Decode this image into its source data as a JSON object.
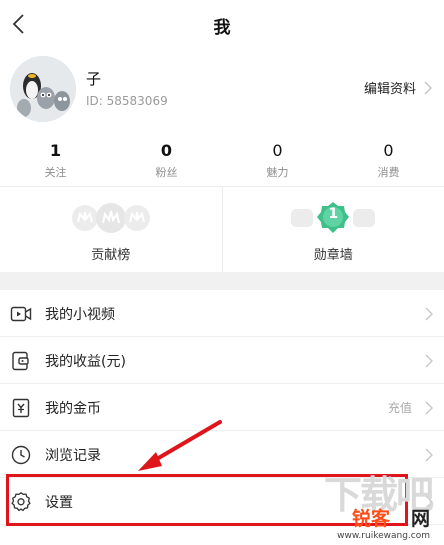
{
  "header": {
    "title": "我"
  },
  "profile": {
    "name": "子",
    "id_text": "ID: 58583069",
    "edit_label": "编辑资料"
  },
  "stats": [
    {
      "value": "1",
      "label": "关注"
    },
    {
      "value": "0",
      "label": "粉丝"
    },
    {
      "value": "0",
      "label": "魅力"
    },
    {
      "value": "0",
      "label": "消费"
    }
  ],
  "badges": {
    "contribution": {
      "label": "贡献榜"
    },
    "medal_wall": {
      "label": "勋章墙",
      "count": "1"
    }
  },
  "menu": [
    {
      "label": "我的小视频",
      "icon": "video-icon"
    },
    {
      "label": "我的收益(元)",
      "icon": "wallet-icon"
    },
    {
      "label": "我的金币",
      "icon": "coin-icon",
      "extra": "充值"
    },
    {
      "label": "浏览记录",
      "icon": "clock-icon"
    },
    {
      "label": "设置",
      "icon": "gear-icon"
    }
  ],
  "watermark": {
    "brand_a": "锐客",
    "brand_b": "网",
    "url": "www.ruikewang.com",
    "bg": "下载吧"
  },
  "colors": {
    "highlight": "#e0141b",
    "medal": "#3fbf8a"
  }
}
